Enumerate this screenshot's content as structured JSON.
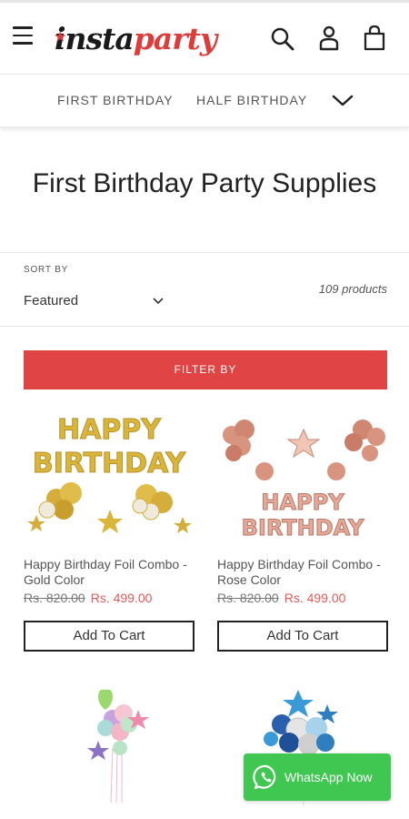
{
  "header": {
    "logo_insta": "insta",
    "logo_party": "party"
  },
  "nav": {
    "items": [
      {
        "label": "FIRST BIRTHDAY"
      },
      {
        "label": "HALF BIRTHDAY"
      }
    ]
  },
  "page": {
    "title": "First Birthday Party Supplies"
  },
  "sort": {
    "label": "SORT BY",
    "selected": "Featured",
    "count": "109 products"
  },
  "filter": {
    "label": "FILTER BY"
  },
  "products": [
    {
      "title": "Happy Birthday Foil Combo - Gold Color",
      "old_price": "Rs. 820.00",
      "new_price": "Rs. 499.00",
      "cta": "Add To Cart",
      "image_text_1": "HAPPY",
      "image_text_2": "BIRTHDAY"
    },
    {
      "title": "Happy Birthday Foil Combo - Rose Color",
      "old_price": "Rs. 820.00",
      "new_price": "Rs. 499.00",
      "cta": "Add To Cart",
      "image_text_1": "HAPPY",
      "image_text_2": "BIRTHDAY"
    }
  ],
  "whatsapp": {
    "label": "WhatsApp Now"
  },
  "colors": {
    "accent_red": "#e04444",
    "brand_red": "#e03b3b",
    "sale_price": "#e05a5a",
    "whatsapp_green": "#3fc751",
    "gold": "#d9b53a",
    "rose": "#d9947f"
  }
}
